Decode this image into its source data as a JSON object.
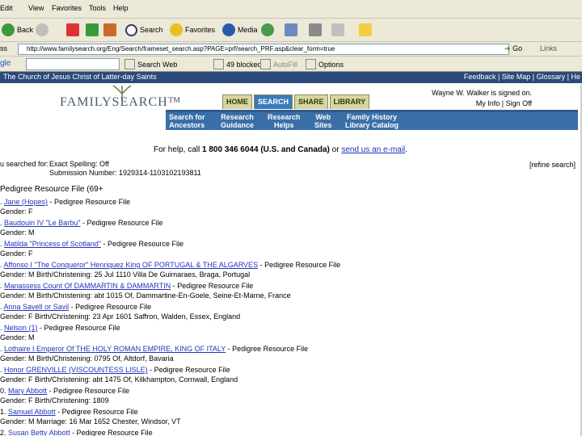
{
  "menu": [
    "Edit",
    "View",
    "Favorites",
    "Tools",
    "Help"
  ],
  "toolbar": {
    "back": "Back",
    "search": "Search",
    "favorites": "Favorites",
    "media": "Media"
  },
  "address": {
    "label": "ss",
    "url": "http://www.familysearch.org/Eng/Search/frameset_search.asp?PAGE=prf/search_PRF.asp&clear_form=true",
    "go": "Go",
    "links": "Links"
  },
  "google": {
    "label": "gle",
    "search_web": "Search Web",
    "blocked": "49 blocked",
    "autofill": "AutoFill",
    "options": "Options"
  },
  "church": {
    "name": "The Church of Jesus Christ of Latter-day Saints",
    "links": "Feedback | Site Map | Glossary | He"
  },
  "site": {
    "logo": "FAMILYSEARCH™",
    "tabs": [
      "HOME",
      "SEARCH",
      "SHARE",
      "LIBRARY"
    ],
    "signed_in": "Wayne W. Walker is signed on.",
    "account_links": "My Info | Sign Off",
    "subnav": [
      {
        "line1": "Search for",
        "line2": "Ancestors"
      },
      {
        "line1": "Research",
        "line2": "Guidance"
      },
      {
        "line1": "Research",
        "line2": "Helps"
      },
      {
        "line1": "Web",
        "line2": "Sites"
      },
      {
        "line1": "Family History",
        "line2": "Library Catalog"
      }
    ]
  },
  "help": {
    "prefix": "For help, call ",
    "phone": "1 800 346 6044 (U.S. and Canada)",
    "or": " or ",
    "link": "send us an e-mail",
    "suffix": "."
  },
  "refine": "[refine search]",
  "searched_for": {
    "label": "u searched for:",
    "line1": "Exact Spelling: Off",
    "line2": "Submission Number: 1929314-1103102193811"
  },
  "results_title": "Pedigree Resource File   (69+",
  "results": [
    {
      "num": ".",
      "name": "Jane (Hopes)",
      "source": " - Pedigree Resource File",
      "detail": "Gender: F"
    },
    {
      "num": ".",
      "name": "Baudouin IV \"Le Barbu\"",
      "source": " - Pedigree Resource File",
      "detail": "Gender: M"
    },
    {
      "num": ".",
      "name": "Matilda \"Princess of Scotland\"",
      "source": " - Pedigree Resource File",
      "detail": "Gender: F"
    },
    {
      "num": ".",
      "name": "Affonso I \"The Conqueror\" Henriquez King OF PORTUGAL & THE ALGARVES",
      "source": " - Pedigree Resource File",
      "detail": "Gender: M Birth/Christening: 25 Jul 1110   Villa De Guimaraes, Braga, Portugal"
    },
    {
      "num": ".",
      "name": "Manassess Count Of DAMMARTIN & DAMMARTIN",
      "source": " - Pedigree Resource File",
      "detail": "Gender: M Birth/Christening: abt 1015 Of, Dammartine-En-Goele, Seine-Et-Marne, France"
    },
    {
      "num": ".",
      "name": "Anna Savell or Savil",
      "source": " - Pedigree Resource File",
      "detail": "Gender: F Birth/Christening: 23 Apr 1601 Saffron, Walden, Essex, England"
    },
    {
      "num": ".",
      "name": "Nelson (1)",
      "source": " - Pedigree Resource File",
      "detail": "Gender: M"
    },
    {
      "num": ".",
      "name": "Lothaire I Emperor Of THE HOLY ROMAN EMPIRE, KING OF ITALY",
      "source": " - Pedigree Resource File",
      "detail": "Gender: M Birth/Christening: 0795 Of, Altdorf, Bavaria"
    },
    {
      "num": ".",
      "name": "Honor GRENVILLE (VISCOUNTESS LISLE)",
      "source": " - Pedigree Resource File",
      "detail": "Gender: F Birth/Christening: abt 1475 Of, Kilkhampton, Cornwall, England"
    },
    {
      "num": "0.",
      "name": "Mary Abbott",
      "source": " - Pedigree Resource File",
      "detail": "Gender: F Birth/Christening: 1809"
    },
    {
      "num": "1.",
      "name": "Samuel Abbott",
      "source": " - Pedigree Resource File",
      "detail": "Gender: M Marriage: 16 Mar 1652 Chester, Windsor, VT"
    },
    {
      "num": "2.",
      "name": "Susan Betty Abbott",
      "source": " - Pedigree Resource File",
      "detail": ""
    }
  ],
  "colors": {
    "link": "#2233bb",
    "church_bar": "#2b4a7a",
    "nav_blue": "#3a6fa8"
  }
}
